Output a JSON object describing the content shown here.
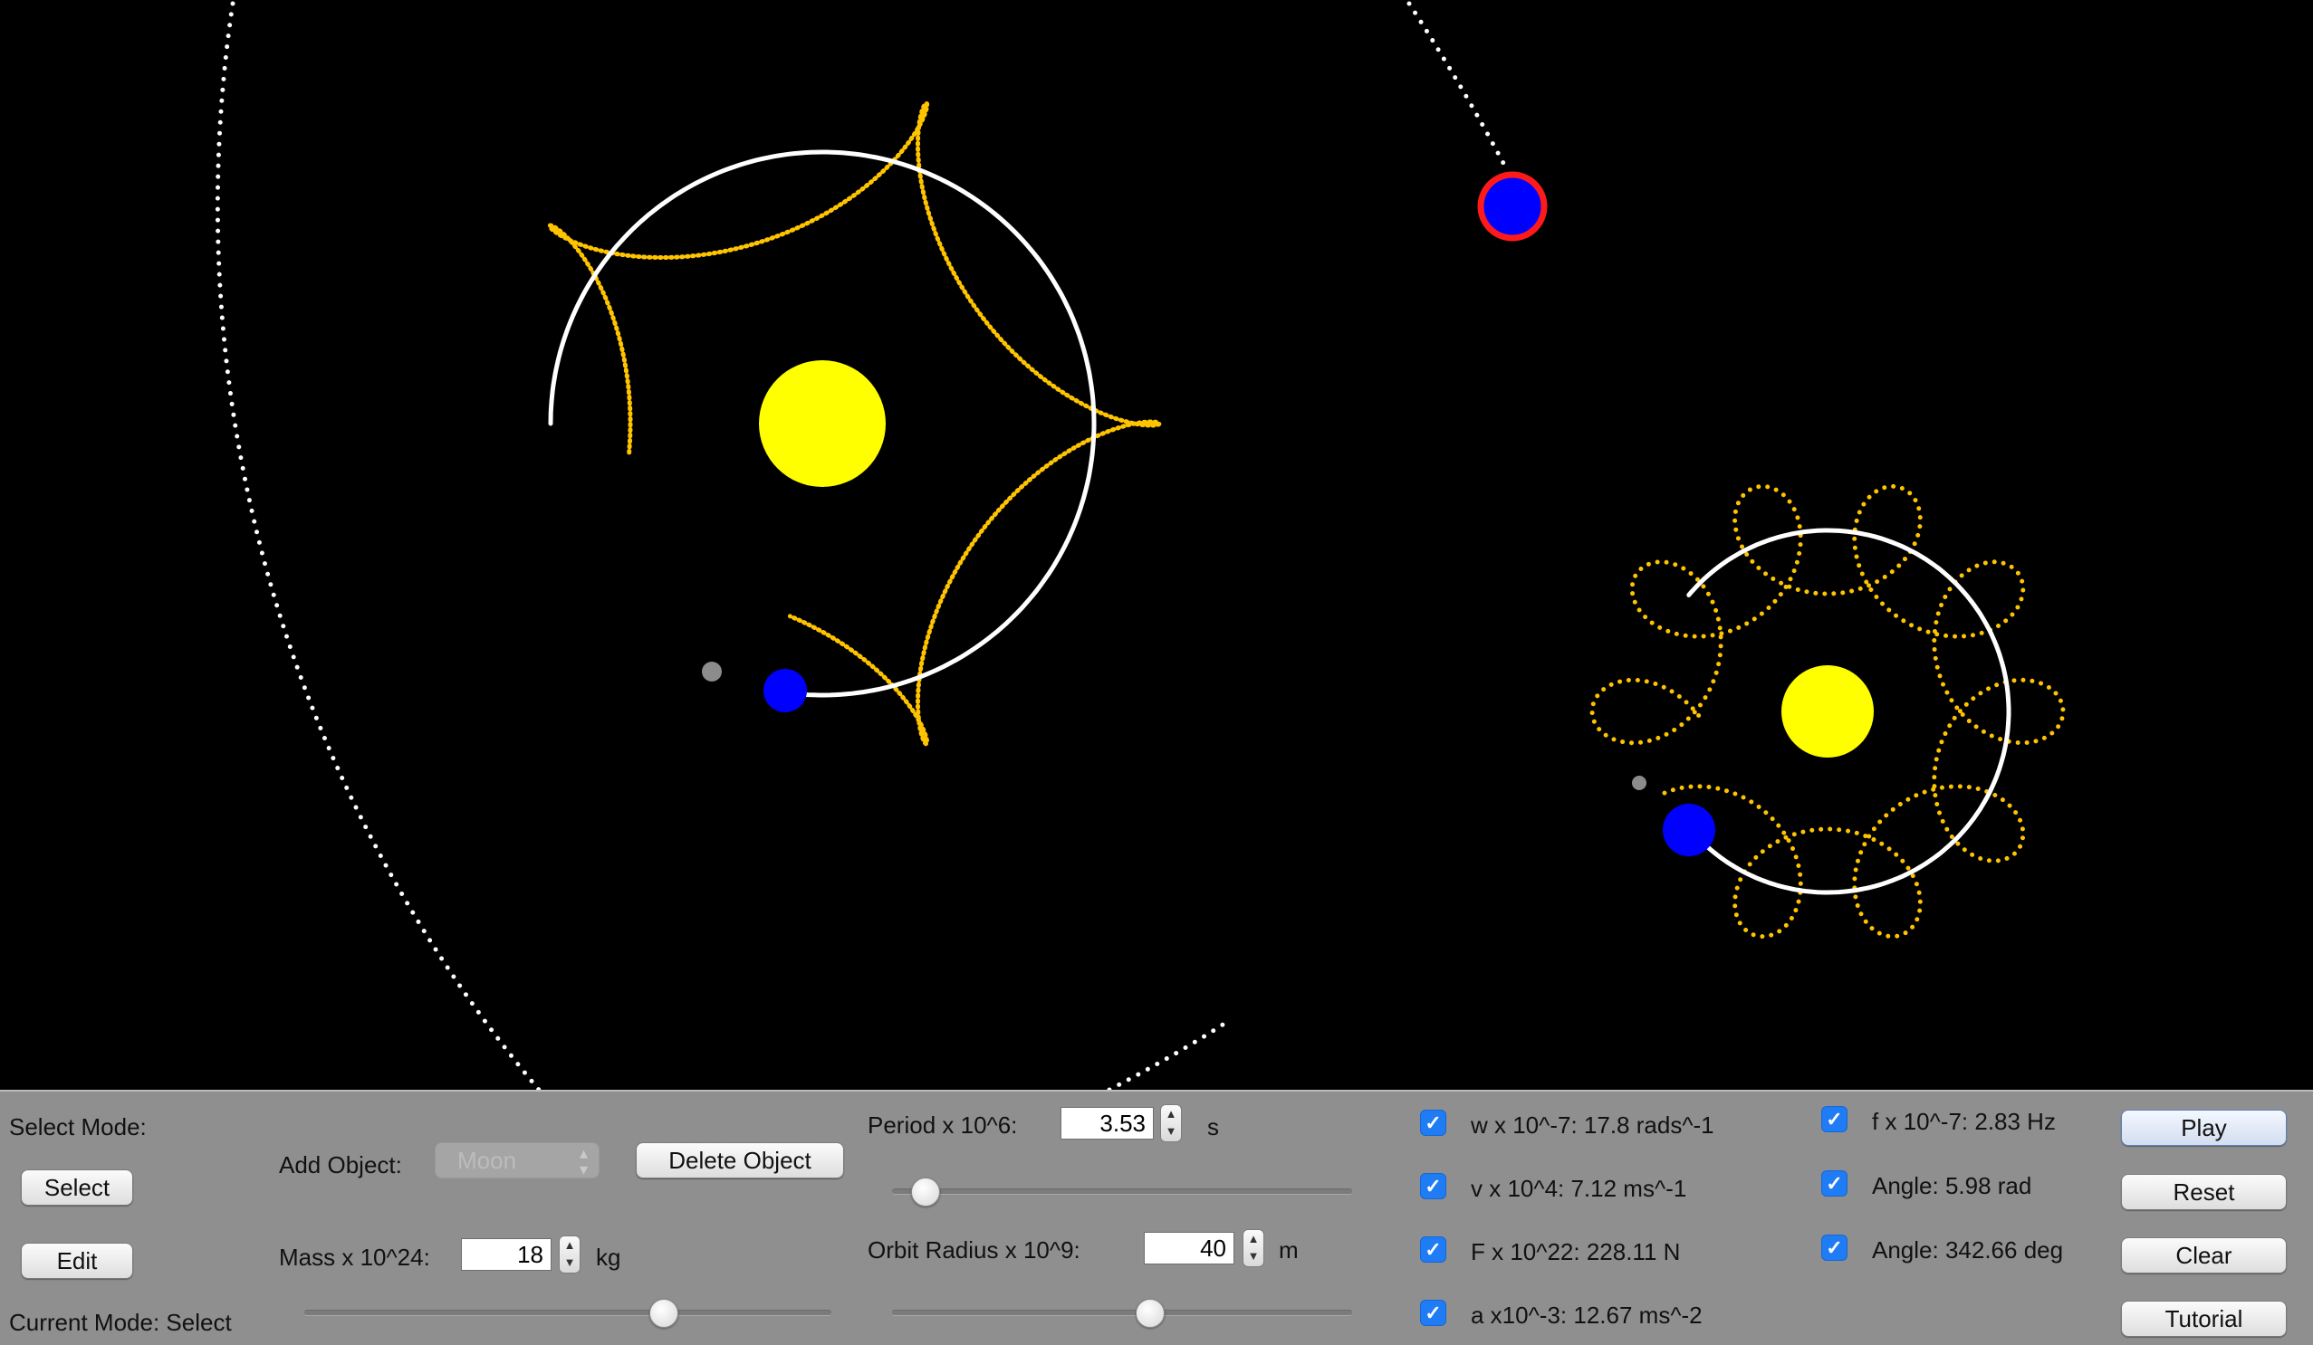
{
  "colors": {
    "sun": "#ffff00",
    "planet": "#0000ff",
    "selected_outline": "#ff1a1a",
    "trail_moon": "#ffc400",
    "trail_orbit": "#ffffff",
    "panel_bg": "#8f8f8f",
    "checkbox": "#1f7cf5"
  },
  "controls": {
    "select_mode_label": "Select Mode:",
    "select_button": "Select",
    "edit_button": "Edit",
    "current_mode": "Current Mode: Select",
    "add_object_label": "Add Object:",
    "add_object_value": "Moon",
    "delete_object_button": "Delete Object",
    "mass_label": "Mass x 10^24:",
    "mass_value": "18",
    "mass_unit": "kg",
    "mass_slider_fraction": 0.68,
    "period_label": "Period x 10^6:",
    "period_value": "3.53",
    "period_unit": "s",
    "period_slider_fraction": 0.07,
    "orbit_radius_label": "Orbit Radius x 10^9:",
    "orbit_radius_value": "40",
    "orbit_radius_unit": "m",
    "orbit_radius_slider_fraction": 0.56
  },
  "readouts": {
    "w": {
      "text": "w x 10^-7: 17.8 rads^-1",
      "checked": true
    },
    "v": {
      "text": "v x 10^4: 7.12 ms^-1",
      "checked": true
    },
    "F": {
      "text": "F x 10^22: 228.11 N",
      "checked": true
    },
    "a": {
      "text": "a x10^-3: 12.67 ms^-2",
      "checked": true
    },
    "f": {
      "text": "f x 10^-7: 2.83 Hz",
      "checked": true
    },
    "angle_rad": {
      "text": "Angle: 5.98 rad",
      "checked": true
    },
    "angle_deg": {
      "text": "Angle: 342.66 deg",
      "checked": true
    }
  },
  "actions": {
    "play": "Play",
    "reset": "Reset",
    "clear": "Clear",
    "tutorial": "Tutorial"
  }
}
